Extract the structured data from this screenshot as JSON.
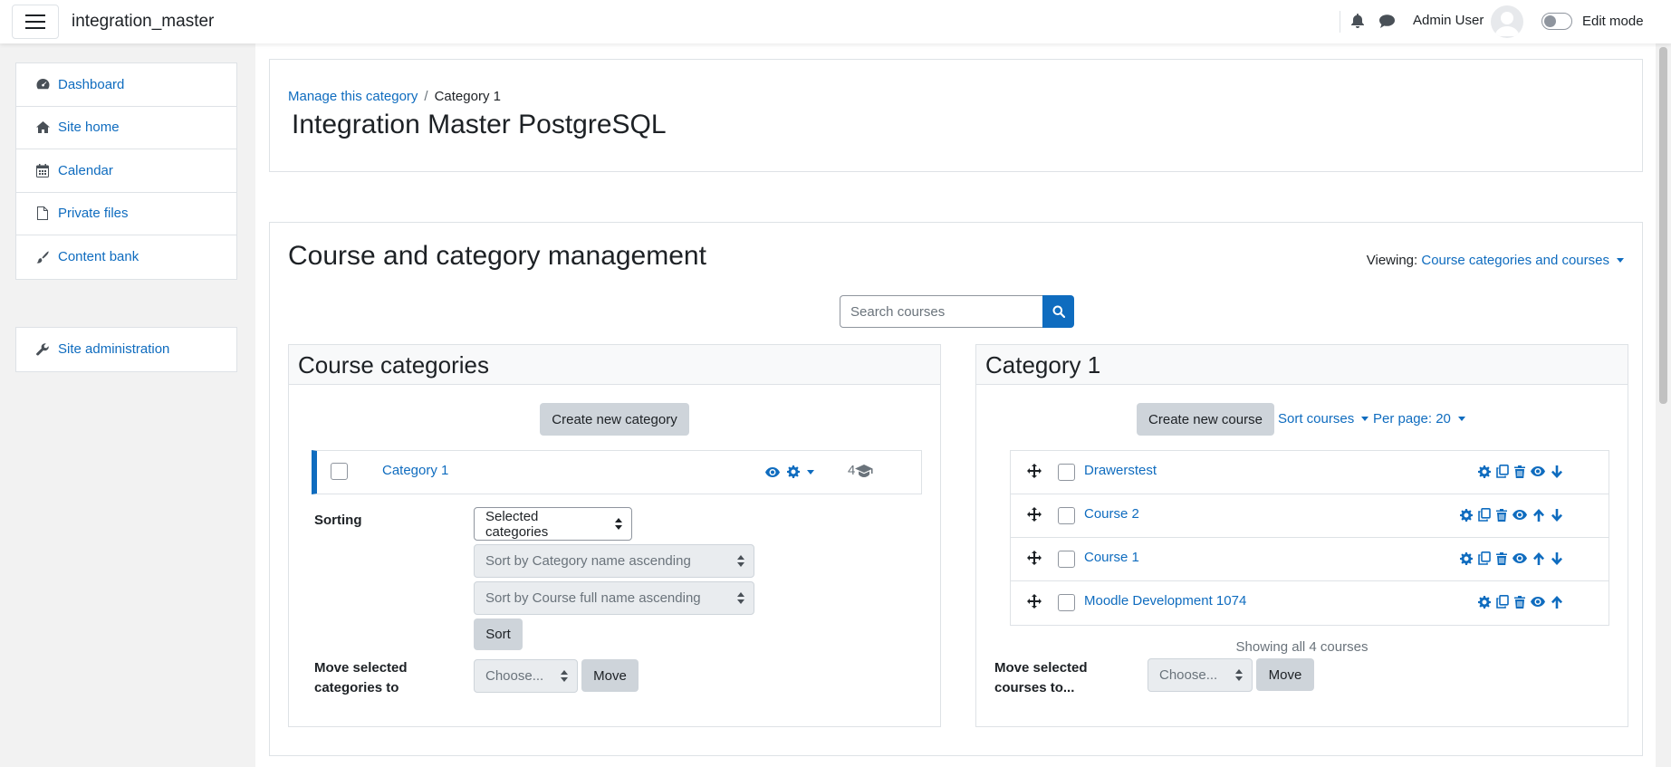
{
  "navbar": {
    "site_name": "integration_master",
    "user_name": "Admin User",
    "edit_mode_label": "Edit mode"
  },
  "drawer": {
    "items": [
      {
        "label": "Dashboard",
        "icon": "dashboard-icon"
      },
      {
        "label": "Site home",
        "icon": "home-icon"
      },
      {
        "label": "Calendar",
        "icon": "calendar-icon"
      },
      {
        "label": "Private files",
        "icon": "file-icon"
      },
      {
        "label": "Content bank",
        "icon": "paintbrush-icon"
      }
    ],
    "admin_item": {
      "label": "Site administration",
      "icon": "wrench-icon"
    }
  },
  "header": {
    "breadcrumb": [
      {
        "label": "Manage this category",
        "link": true
      },
      {
        "label": "Category 1",
        "link": false
      }
    ],
    "title": "Integration Master PostgreSQL"
  },
  "management": {
    "title": "Course and category management",
    "viewing_label": "Viewing:",
    "viewing_value": "Course categories and courses",
    "search_placeholder": "Search courses"
  },
  "categories_panel": {
    "title": "Course categories",
    "create_button": "Create new category",
    "category": {
      "name": "Category 1",
      "course_count": "4"
    },
    "sorting_label": "Sorting",
    "sort_scope_value": "Selected categories",
    "sort_category_placeholder": "Sort by Category name ascending",
    "sort_course_placeholder": "Sort by Course full name ascending",
    "sort_button": "Sort",
    "move_label": "Move selected categories to",
    "move_placeholder": "Choose...",
    "move_button": "Move"
  },
  "courses_panel": {
    "title": "Category 1",
    "create_button": "Create new course",
    "sort_link": "Sort courses",
    "per_page_link": "Per page: 20",
    "courses": [
      {
        "name": "Drawerstest",
        "actions": [
          "gear-icon",
          "copy-icon",
          "trash-icon",
          "eye-icon",
          "arrow-down-icon"
        ]
      },
      {
        "name": "Course 2",
        "actions": [
          "gear-icon",
          "copy-icon",
          "trash-icon",
          "eye-icon",
          "arrow-up-icon",
          "arrow-down-icon"
        ]
      },
      {
        "name": "Course 1",
        "actions": [
          "gear-icon",
          "copy-icon",
          "trash-icon",
          "eye-icon",
          "arrow-up-icon",
          "arrow-down-icon"
        ]
      },
      {
        "name": "Moodle Development 1074",
        "actions": [
          "gear-icon",
          "copy-icon",
          "trash-icon",
          "eye-icon",
          "arrow-up-icon"
        ]
      }
    ],
    "showing_text": "Showing all 4 courses",
    "move_label": "Move selected courses to...",
    "move_placeholder": "Choose...",
    "move_button": "Move"
  },
  "colors": {
    "link": "#0f6cbf",
    "primary": "#0f6cbf",
    "secondary_button": "#ced4da",
    "drawer_bg": "#f2f2f2",
    "border": "#dee2e6"
  }
}
